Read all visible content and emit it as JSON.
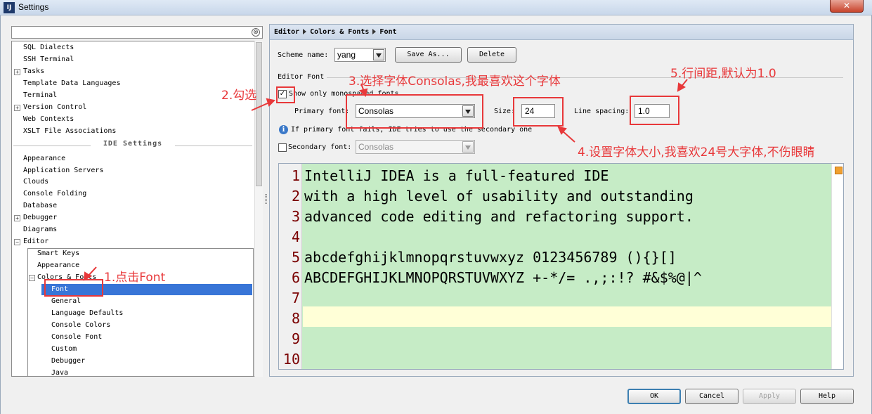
{
  "window": {
    "title": "Settings",
    "app_icon": "IJ",
    "close_glyph": "✕"
  },
  "search": {
    "value": "",
    "clear_glyph": "⊗"
  },
  "sidebar": {
    "items": [
      {
        "label": "SQL Dialects",
        "expandable": false
      },
      {
        "label": "SSH Terminal",
        "expandable": false
      },
      {
        "label": "Tasks",
        "expandable": true
      },
      {
        "label": "Template Data Languages",
        "expandable": false
      },
      {
        "label": "Terminal",
        "expandable": false
      },
      {
        "label": "Version Control",
        "expandable": true
      },
      {
        "label": "Web Contexts",
        "expandable": false
      },
      {
        "label": "XSLT File Associations",
        "expandable": false
      }
    ],
    "ide_section": "IDE Settings",
    "ide_items": [
      {
        "label": "Appearance",
        "expandable": false
      },
      {
        "label": "Application Servers",
        "expandable": false
      },
      {
        "label": "Clouds",
        "expandable": false
      },
      {
        "label": "Console Folding",
        "expandable": false
      },
      {
        "label": "Database",
        "expandable": false
      },
      {
        "label": "Debugger",
        "expandable": true
      },
      {
        "label": "Diagrams",
        "expandable": false
      },
      {
        "label": "Editor",
        "expandable": true,
        "expanded": true
      }
    ],
    "editor_children": [
      "Smart Keys",
      "Appearance",
      "Colors & Fonts"
    ],
    "colors_fonts_children": [
      "Font",
      "General",
      "Language Defaults",
      "Console Colors",
      "Console Font",
      "Custom",
      "Debugger",
      "Java"
    ],
    "selected": "Font",
    "expand_glyph": "+",
    "collapse_glyph": "−"
  },
  "breadcrumb": [
    "Editor",
    "Colors & Fonts",
    "Font"
  ],
  "scheme": {
    "label": "Scheme name:",
    "value": "yang",
    "save_as": "Save As...",
    "delete": "Delete"
  },
  "editor_font": {
    "group_label": "Editor Font",
    "monospaced_label": "Show only monospaced fonts",
    "monospaced_checked": true,
    "check_glyph": "✓",
    "primary_label": "Primary font:",
    "primary_value": "Consolas",
    "size_label": "Size:",
    "size_value": "24",
    "spacing_label": "Line spacing:",
    "spacing_value": "1.0",
    "info_glyph": "i",
    "info_text": "If primary font fails, IDE tries to use the secondary one",
    "secondary_label": "Secondary font:",
    "secondary_value": "Consolas",
    "secondary_checked": false
  },
  "preview": {
    "line_numbers": [
      "1",
      "2",
      "3",
      "4",
      "5",
      "6",
      "7",
      "8",
      "9",
      "10"
    ],
    "lines": [
      "IntelliJ IDEA is a full-featured IDE",
      "with a high level of usability and outstanding",
      "advanced code editing and refactoring support.",
      "",
      "abcdefghijklmnopqrstuvwxyz 0123456789 (){}[]",
      "ABCDEFGHIJKLMNOPQRSTUVWXYZ +-*/= .,;:!? #&$%@|^",
      "",
      "",
      "",
      ""
    ],
    "caret_line": 8
  },
  "buttons": {
    "ok": "OK",
    "cancel": "Cancel",
    "apply": "Apply",
    "help": "Help"
  },
  "annotations": {
    "a1": "1.点击Font",
    "a2": "2.勾选",
    "a3": "3.选择字体Consolas,我最喜欢这个字体",
    "a4": "4.设置字体大小,我喜欢24号大字体,不伤眼睛",
    "a5": "5.行间距,默认为1.0",
    "color": "#e8383a"
  },
  "colors": {
    "preview_bg": "#c6ecc6",
    "caret_row": "#ffffd7",
    "line_number": "#7a0000",
    "selection": "#3875d7"
  }
}
